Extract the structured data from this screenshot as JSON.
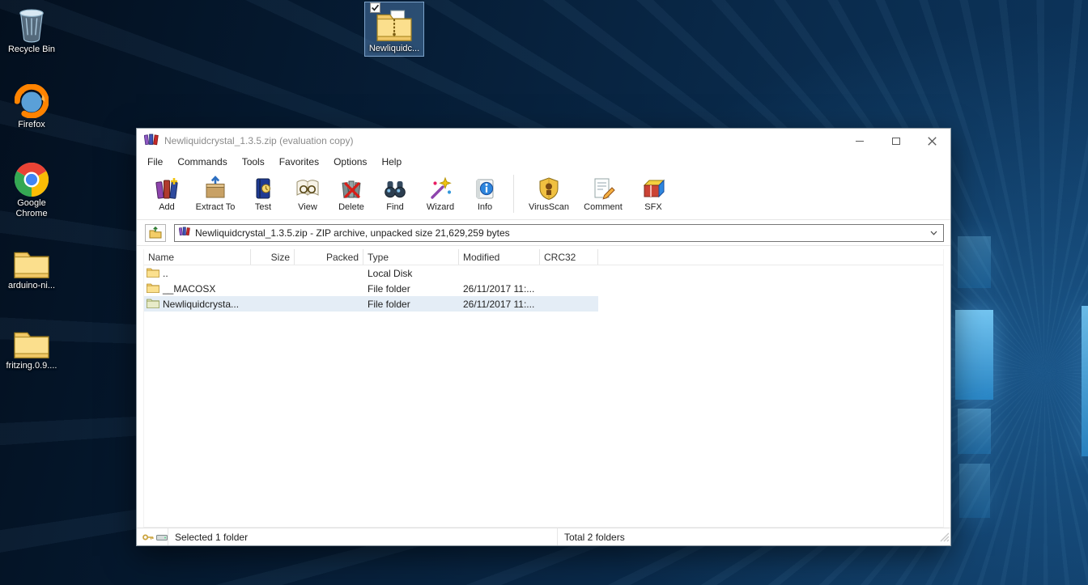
{
  "desktop": {
    "icons": [
      {
        "label": "Recycle Bin"
      },
      {
        "label": "Firefox"
      },
      {
        "label": "Google Chrome"
      },
      {
        "label": "arduino-ni..."
      },
      {
        "label": "fritzing.0.9...."
      }
    ],
    "selected_icon": {
      "label": "Newliquidc..."
    }
  },
  "winrar": {
    "title": "Newliquidcrystal_1.3.5.zip (evaluation copy)",
    "menu": [
      {
        "label": "File"
      },
      {
        "label": "Commands"
      },
      {
        "label": "Tools"
      },
      {
        "label": "Favorites"
      },
      {
        "label": "Options"
      },
      {
        "label": "Help"
      }
    ],
    "toolbar": [
      {
        "label": "Add"
      },
      {
        "label": "Extract To"
      },
      {
        "label": "Test"
      },
      {
        "label": "View"
      },
      {
        "label": "Delete"
      },
      {
        "label": "Find"
      },
      {
        "label": "Wizard"
      },
      {
        "label": "Info"
      },
      {
        "label": "VirusScan"
      },
      {
        "label": "Comment"
      },
      {
        "label": "SFX"
      }
    ],
    "address": "Newliquidcrystal_1.3.5.zip - ZIP archive, unpacked size 21,629,259 bytes",
    "columns": [
      {
        "label": "Name"
      },
      {
        "label": "Size"
      },
      {
        "label": "Packed"
      },
      {
        "label": "Type"
      },
      {
        "label": "Modified"
      },
      {
        "label": "CRC32"
      }
    ],
    "rows": [
      {
        "name": "..",
        "size": "",
        "packed": "",
        "type": "Local Disk",
        "modified": "",
        "crc32": ""
      },
      {
        "name": "__MACOSX",
        "size": "",
        "packed": "",
        "type": "File folder",
        "modified": "26/11/2017 11:...",
        "crc32": ""
      },
      {
        "name": "Newliquidcrysta...",
        "size": "",
        "packed": "",
        "type": "File folder",
        "modified": "26/11/2017 11:...",
        "crc32": ""
      }
    ],
    "status": {
      "selected": "Selected 1 folder",
      "total": "Total 2 folders"
    }
  }
}
